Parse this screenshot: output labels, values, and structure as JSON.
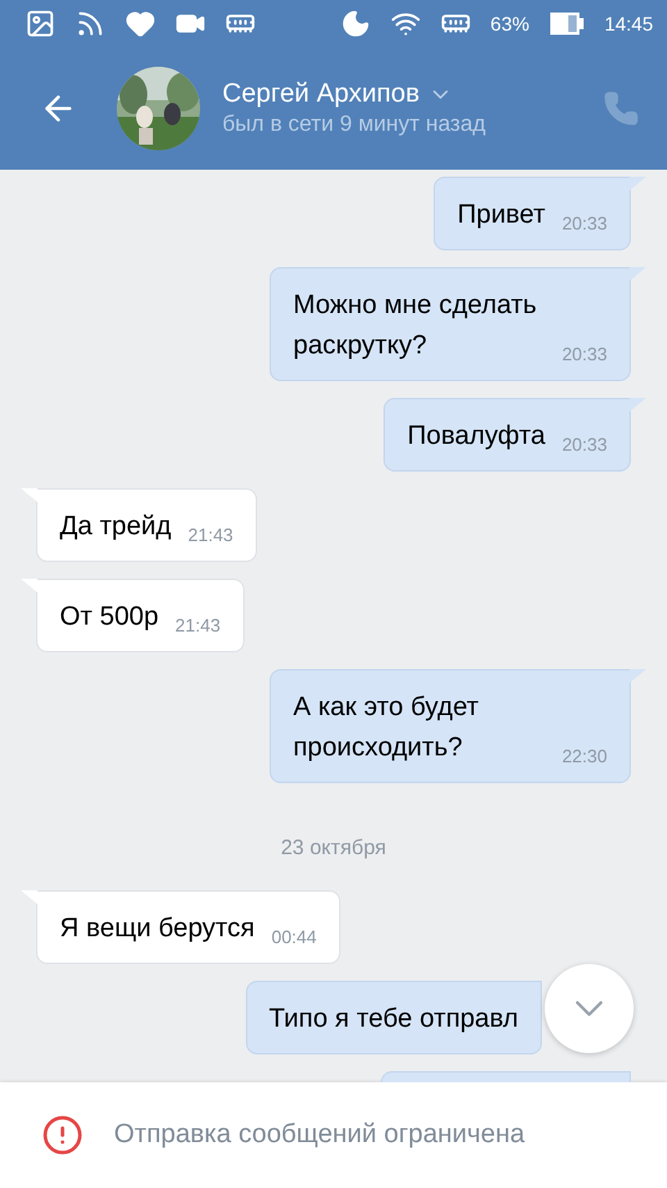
{
  "status_bar": {
    "battery_text": "63%",
    "time": "14:45"
  },
  "header": {
    "name": "Сергей Архипов",
    "status": "был в сети 9 минут назад"
  },
  "messages": [
    {
      "kind": "message",
      "outgoing": true,
      "text": "Привет",
      "time": "20:33"
    },
    {
      "kind": "message",
      "outgoing": true,
      "text": "Можно мне сделать раскрутку?",
      "time": "20:33"
    },
    {
      "kind": "message",
      "outgoing": true,
      "text": "Повалуфта",
      "time": "20:33"
    },
    {
      "kind": "message",
      "outgoing": false,
      "text": "Да трейд",
      "time": "21:43"
    },
    {
      "kind": "message",
      "outgoing": false,
      "text": "От 500р",
      "time": "21:43"
    },
    {
      "kind": "message",
      "outgoing": true,
      "text": "А как это будет происходить?",
      "time": "22:30"
    },
    {
      "kind": "date",
      "text": "23 октября"
    },
    {
      "kind": "message",
      "outgoing": false,
      "text": "Я вещи берутся",
      "time": "00:44"
    },
    {
      "kind": "message",
      "outgoing": true,
      "text": "Типо я тебе отправл"
    },
    {
      "kind": "message",
      "outgoing": true
    }
  ],
  "notice": {
    "text": "Отправка сообщений ограничена"
  }
}
